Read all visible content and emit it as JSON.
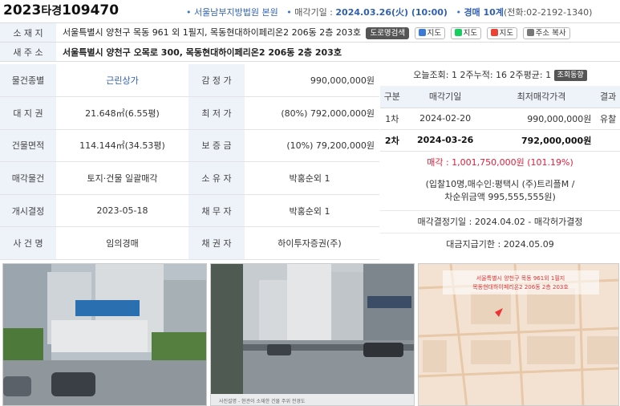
{
  "header": {
    "case_year": "2023",
    "case_type": "타경",
    "case_no": "109470",
    "court": "서울남부지방법원 본원",
    "date_label": "매각기일 : ",
    "date_value": "2024.03.26(火) (10:00)",
    "dept_label": "경매 10계",
    "phone": "(전화:02-2192-1340)"
  },
  "address": {
    "loc_label": "소 재 지",
    "loc_value": "서울특별시 양천구 목동 961 외 1필지, 목동현대하이페리온2 206동 2층 203호",
    "new_label": "새 주 소",
    "new_value": "서울특별시 양천구 오목로 300, 목동현대하이페리온2 206동 2층 203호",
    "buttons": {
      "road": "도로명검색",
      "daum": "지도",
      "naver": "지도",
      "google": "지도",
      "copy": "주소 복사"
    }
  },
  "details": {
    "type_label": "물건종별",
    "type_value": "근린상가",
    "appraisal_label": "감 정 가",
    "appraisal_value": "990,000,000원",
    "land_label": "대 지 권",
    "land_value": "21.648㎡(6.55평)",
    "min_label": "최 저 가",
    "min_value": "(80%) 792,000,000원",
    "bld_label": "건물면적",
    "bld_value": "114.144㎡(34.53평)",
    "deposit_label": "보 증 금",
    "deposit_value": "(10%) 79,200,000원",
    "sale_obj_label": "매각물건",
    "sale_obj_value": "토지·건물 일괄매각",
    "owner_label": "소 유 자",
    "owner_value": "박홍순외 1",
    "start_label": "개시결정",
    "start_value": "2023-05-18",
    "debtor_label": "채 무 자",
    "debtor_value": "박홍순외 1",
    "case_label": "사 건 명",
    "case_value": "임의경매",
    "creditor_label": "채 권 자",
    "creditor_value": "하이투자증권(주)"
  },
  "views": {
    "text": "오늘조회: 1  2주누적: 16  2주평균: 1",
    "button": "조회동향"
  },
  "rounds": {
    "headers": [
      "구분",
      "매각기일",
      "최저매각가격",
      "결과"
    ],
    "rows": [
      {
        "round": "1차",
        "date": "2024-02-20",
        "price": "990,000,000원",
        "result": "유찰"
      },
      {
        "round": "2차",
        "date": "2024-03-26",
        "price": "792,000,000원",
        "result": ""
      }
    ]
  },
  "sale": {
    "label": "매각 : ",
    "value": "1,001,750,000원",
    "ratio": "(101.19%)"
  },
  "buyers": {
    "line1": "(입찰10명,매수인:평택시 (주)트리플M /",
    "line2": "차순위금액 995,555,555원)"
  },
  "decision": "매각결정기일 : 2024.04.02 - 매각허가결정",
  "payment": "대금지급기한 : 2024.05.09",
  "photos": {
    "caption2": "사진설명 - 현관이 소재한 건물 주위 전경도",
    "map_text1": "서울특별시 양천구 목동 961외 1필지",
    "map_text2": "목동현대하이페리온2 206동 2층 203호"
  },
  "colors": {
    "accent": "#2f5fb3",
    "label_bg": "#eef3fa",
    "sale_red": "#e0203b"
  }
}
